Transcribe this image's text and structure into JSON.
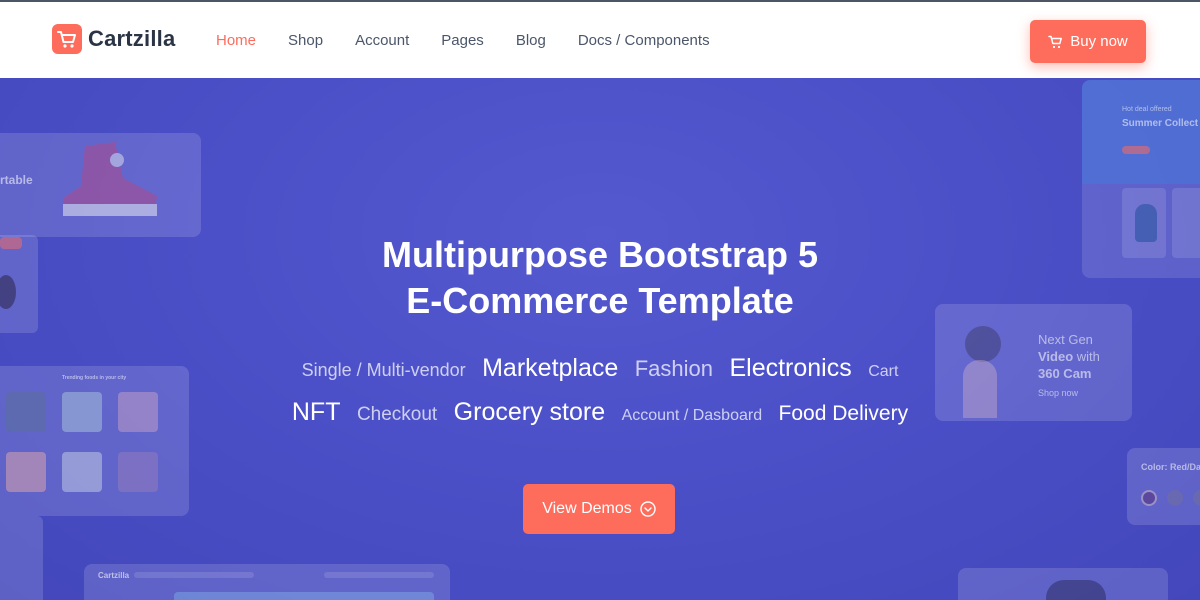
{
  "brand": {
    "name": "Cartzilla",
    "logo_icon": "cart-logo-icon"
  },
  "nav": {
    "items": [
      {
        "label": "Home",
        "active": true
      },
      {
        "label": "Shop",
        "active": false
      },
      {
        "label": "Account",
        "active": false
      },
      {
        "label": "Pages",
        "active": false
      },
      {
        "label": "Blog",
        "active": false
      },
      {
        "label": "Docs / Components",
        "active": false
      }
    ]
  },
  "header": {
    "buy_label": "Buy now",
    "buy_icon": "cart-icon"
  },
  "hero": {
    "title_line1_light": "Multipurpose ",
    "title_line1_bold": "Bootstrap 5",
    "title_line2_bold": "E-Commerce",
    "title_line2_light": " Template",
    "tags_row1": [
      "Single / Multi-vendor",
      "Marketplace",
      "Fashion",
      "Electronics",
      "Cart"
    ],
    "tags_row2": [
      "NFT",
      "Checkout",
      "Grocery store",
      "Account / Dasboard",
      "Food Delivery"
    ],
    "cta_label": "View Demos",
    "cta_icon": "chevron-circle-down-icon"
  },
  "background_cards": {
    "sneaker_text": "rtable",
    "trending_text": "Trending foods in your city",
    "summer_small": "Hot deal offered",
    "summer_title": "Summer Collect",
    "camera_line1": "Next Gen",
    "camera_line2": "Video",
    "camera_line2b": " with",
    "camera_line3": "360 Cam",
    "camera_link": "Shop now",
    "color_label": "Color: Red/Da",
    "mini_brand": "Cartzilla"
  },
  "colors": {
    "accent": "#fe6c5c",
    "hero_bg": "#4a4fc6",
    "text_dark": "#2b3445",
    "nav_text": "#4b566b"
  }
}
